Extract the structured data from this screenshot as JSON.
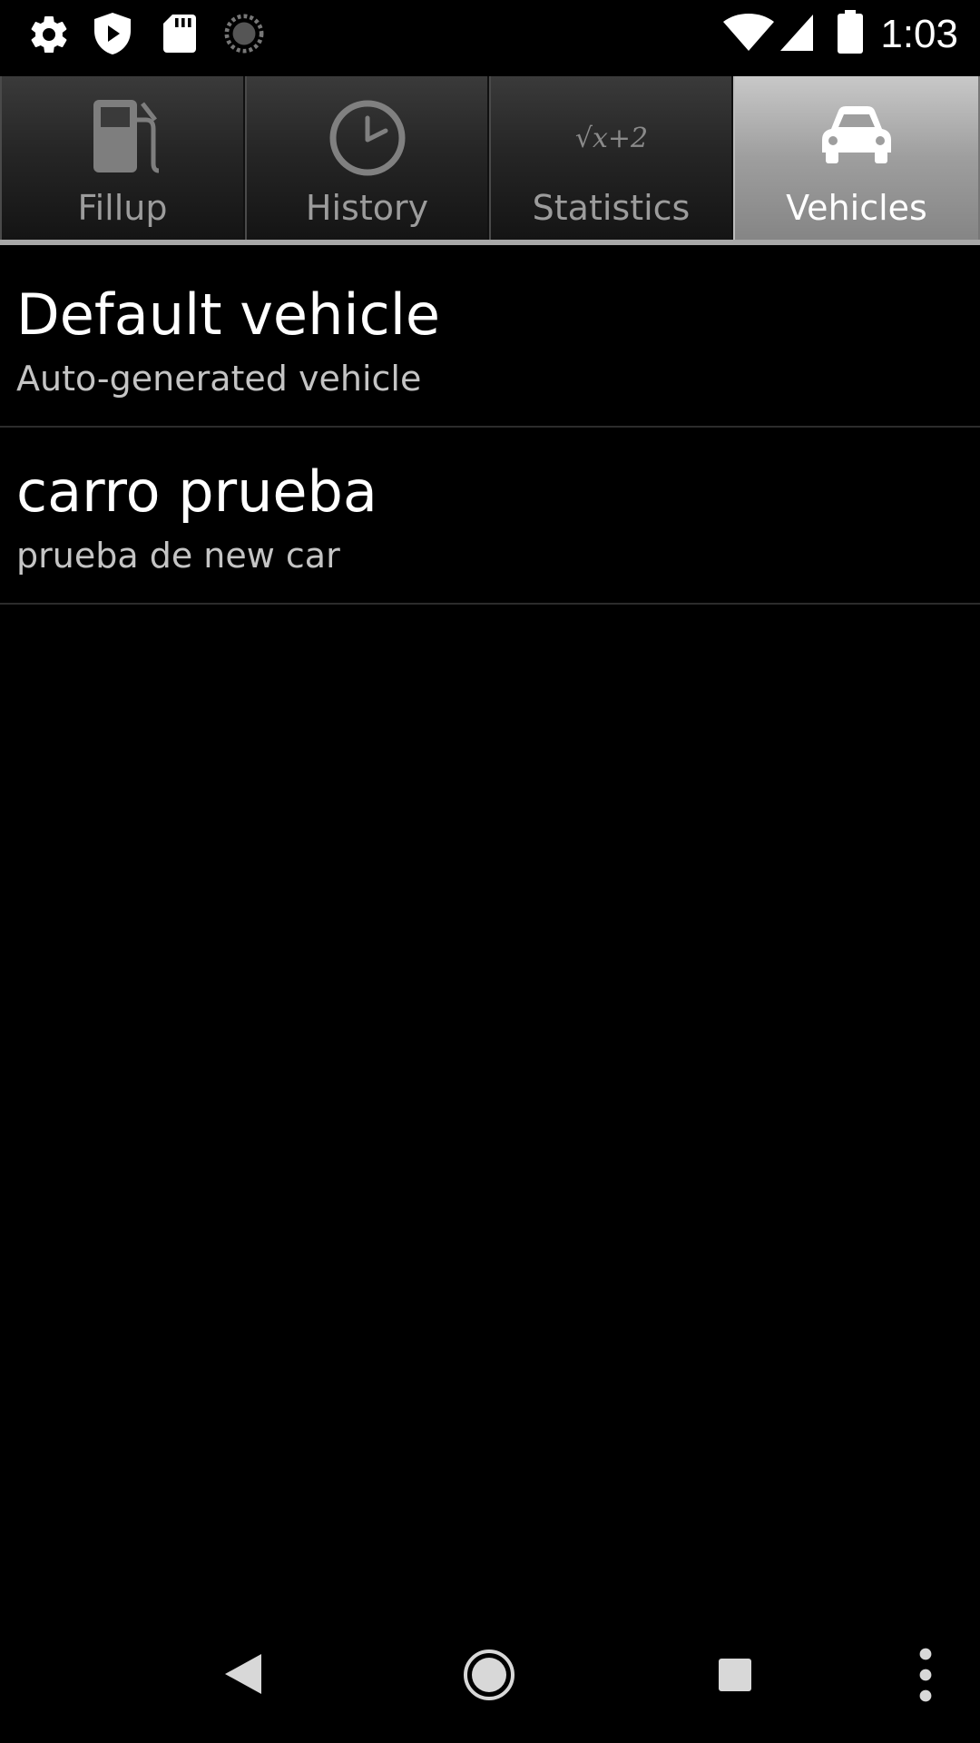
{
  "status_bar": {
    "time": "1:03",
    "left_icons": [
      "settings-icon",
      "shield-play-icon",
      "sd-card-icon",
      "sync-circle-icon"
    ],
    "right_icons": [
      "wifi-icon",
      "cell-signal-icon",
      "battery-icon"
    ]
  },
  "tabs": [
    {
      "label": "Fillup",
      "icon": "fuel-pump-icon",
      "active": false
    },
    {
      "label": "History",
      "icon": "clock-icon",
      "active": false
    },
    {
      "label": "Statistics",
      "icon": "math-formula-icon",
      "icon_text": "√x+2",
      "active": false
    },
    {
      "label": "Vehicles",
      "icon": "car-icon",
      "active": true
    }
  ],
  "vehicles": [
    {
      "name": "Default vehicle",
      "description": "Auto-generated vehicle"
    },
    {
      "name": "carro prueba",
      "description": "prueba de new car"
    }
  ],
  "nav_bar": {
    "buttons": [
      "back-icon",
      "home-icon",
      "recents-icon",
      "overflow-menu-icon"
    ]
  },
  "colors": {
    "background": "#000000",
    "active_tab": "#9e9e9e",
    "inactive_label": "#9c9c9c"
  }
}
